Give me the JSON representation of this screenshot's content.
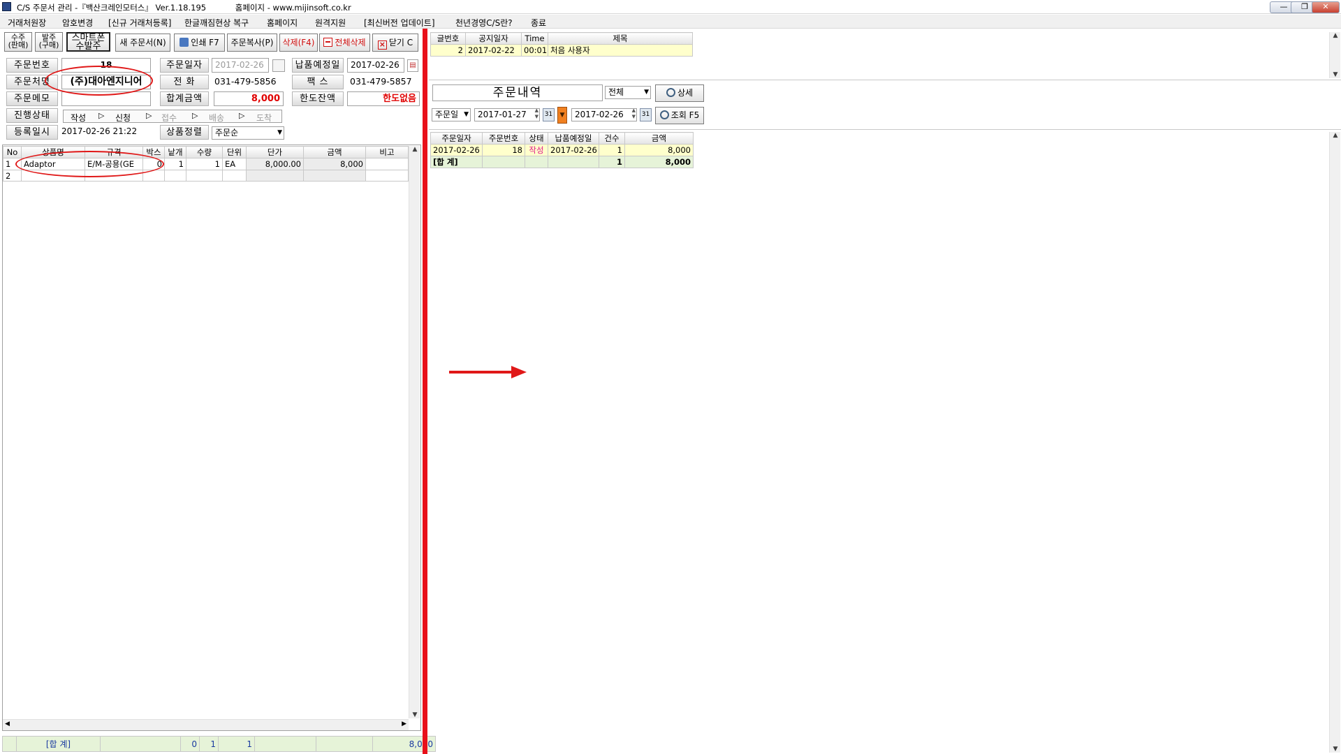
{
  "window": {
    "title": "C/S 주문서 관리 -『백산크레인모터스』 Ver.1.18.195",
    "homepage": "홈페이지 - www.mijinsoft.co.kr",
    "controls": [
      "—",
      "❐",
      "✕"
    ]
  },
  "menu": [
    "거래처원장",
    "암호변경",
    "[신규 거래처등록]",
    "한글깨짐현상 복구",
    "홈페이지",
    "원격지원",
    "[최신버전 업데이트]",
    "천년경영C/S란?",
    "종료"
  ],
  "toolbar": {
    "sales_1": "수주",
    "sales_2": "(판매)",
    "purchase_1": "발주",
    "purchase_2": "(구매)",
    "smart_1": "스마트폰",
    "smart_2": "수발주",
    "new_order": "새 주문서(N)",
    "print": "인쇄 F7",
    "copy": "주문복사(P)",
    "delete": "삭제(F4)",
    "delete_all": "전체삭제",
    "close": "닫기 C"
  },
  "form": {
    "order_no_label": "주문번호",
    "order_no": "18",
    "order_date_label": "주문일자",
    "order_date": "2017-02-26",
    "delivery_label": "납품예정일",
    "delivery_date": "2017-02-26",
    "customer_label": "주문처명",
    "customer": "(주)대아엔지니어",
    "phone_label": "전   화",
    "phone": "031-479-5856",
    "fax_label": "팩   스",
    "fax": "031-479-5857",
    "memo_label": "주문메모",
    "memo": "",
    "total_label": "합계금액",
    "total": "8,000",
    "credit_label": "한도잔액",
    "credit": "한도없음",
    "status_label": "진행상태",
    "status_steps": [
      "작성",
      "신청",
      "접수",
      "배송",
      "도착"
    ],
    "reg_label": "등록일시",
    "reg_time": "2017-02-26 21:22",
    "sort_label": "상품정렬",
    "sort_value": "주문순"
  },
  "items": {
    "headers": [
      "No",
      "상품명",
      "규격",
      "박스",
      "낱개",
      "수량",
      "단위",
      "단가",
      "금액",
      "비고"
    ],
    "rows": [
      [
        "1",
        "Adaptor",
        "E/M-공용(GE",
        "0",
        "1",
        "1",
        "EA",
        "8,000.00",
        "8,000",
        ""
      ],
      [
        "2",
        "",
        "",
        "",
        "",
        "",
        "",
        "",
        "",
        ""
      ]
    ],
    "footer": [
      "[합 계]",
      "0",
      "1",
      "1",
      "8,000"
    ]
  },
  "notices": {
    "headers": [
      "글번호",
      "공지일자",
      "Time",
      "제목"
    ],
    "rows": [
      [
        "2",
        "2017-02-22",
        "00:01",
        "처음 사용자"
      ]
    ]
  },
  "history": {
    "title": "주문내역",
    "filter": "전체",
    "detail_button": "상세",
    "date_type": "주문일",
    "date_from": "2017-01-27",
    "date_to": "2017-02-26",
    "search_button": "조회 F5",
    "headers": [
      "주문일자",
      "주문번호",
      "상태",
      "납품예정일",
      "건수",
      "금액"
    ],
    "rows": [
      [
        "2017-02-26",
        "18",
        "작성",
        "2017-02-26",
        "1",
        "8,000"
      ]
    ],
    "total": [
      "[합 계]",
      "1",
      "8,000"
    ]
  },
  "colors": {
    "divider": "#e8101a",
    "annotation": "#e01818",
    "status_write": "#e0198a",
    "highlight": "#ffffcc"
  }
}
